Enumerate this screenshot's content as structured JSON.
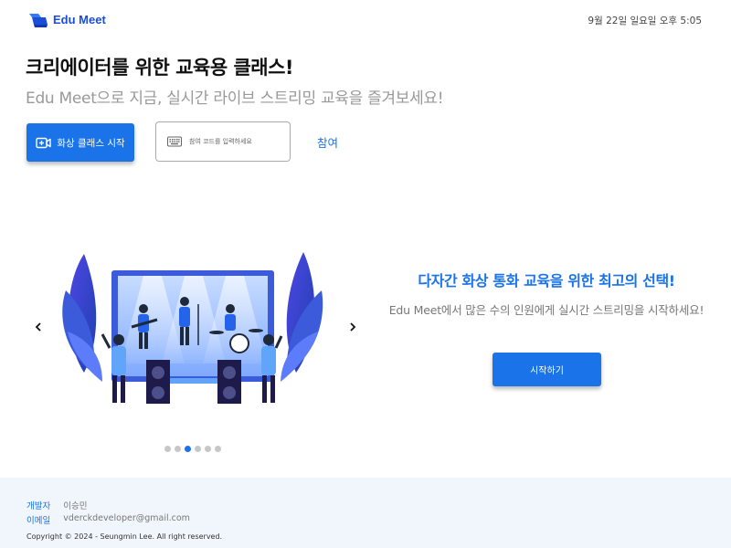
{
  "header": {
    "brand_name": "Edu Meet",
    "datetime": "9월 22일 일요일 오후 5:05"
  },
  "hero": {
    "title": "크리에이터를 위한 교육용 클래스!",
    "subtitle": "Edu Meet으로 지금, 실시간 라이브 스트리밍 교육을 즐겨보세요!",
    "start_button_label": "화상 클래스 시작",
    "code_placeholder": "참여 코드를 입력하세요",
    "code_value": "",
    "join_label": "참여"
  },
  "carousel": {
    "slide": {
      "title": "다자간 화상 통화 교육을 위한 최고의 선택!",
      "description": "Edu Meet에서 많은 수의 인원에게 실시간 스트리밍을 시작하세요!",
      "button_label": "시작하기"
    },
    "dot_count": 6,
    "active_dot": 3,
    "prev_icon": "chevron-left-icon",
    "next_icon": "chevron-right-icon"
  },
  "footer": {
    "developer_key": "개발자",
    "developer_value": "이승민",
    "email_key": "이메일",
    "email_value": "vderckdeveloper@gmail.com",
    "copyright": "Copyright © 2024 - Seungmin Lee. All right reserved."
  },
  "colors": {
    "accent": "#1a73e8",
    "brand": "#1b4ed8",
    "footer_bg": "#f0f6fc"
  }
}
